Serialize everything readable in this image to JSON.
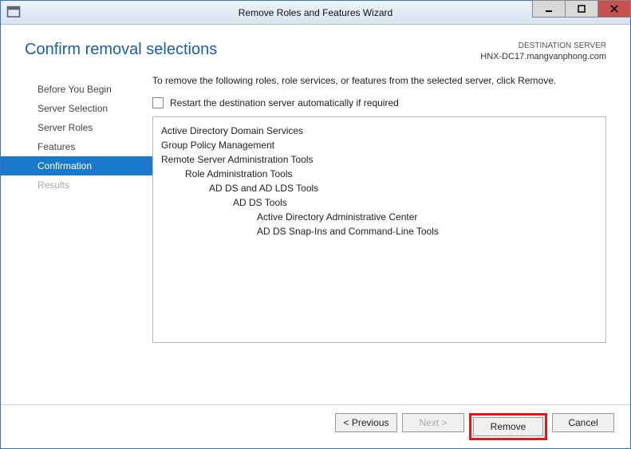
{
  "titlebar": {
    "title": "Remove Roles and Features Wizard"
  },
  "header": {
    "page_title": "Confirm removal selections",
    "dest_label": "DESTINATION SERVER",
    "dest_server": "HNX-DC17.mangvanphong.com"
  },
  "sidebar": {
    "steps": [
      {
        "label": "Before You Begin"
      },
      {
        "label": "Server Selection"
      },
      {
        "label": "Server Roles"
      },
      {
        "label": "Features"
      },
      {
        "label": "Confirmation"
      },
      {
        "label": "Results"
      }
    ]
  },
  "main": {
    "instruction": "To remove the following roles, role services, or features from the selected server, click Remove.",
    "restart_label": "Restart the destination server automatically if required",
    "tree": [
      {
        "level": 0,
        "text": "Active Directory Domain Services"
      },
      {
        "level": 0,
        "text": "Group Policy Management"
      },
      {
        "level": 0,
        "text": "Remote Server Administration Tools"
      },
      {
        "level": 1,
        "text": "Role Administration Tools"
      },
      {
        "level": 2,
        "text": "AD DS and AD LDS Tools"
      },
      {
        "level": 3,
        "text": "AD DS Tools"
      },
      {
        "level": 4,
        "text": "Active Directory Administrative Center"
      },
      {
        "level": 4,
        "text": "AD DS Snap-Ins and Command-Line Tools"
      }
    ]
  },
  "footer": {
    "previous": "< Previous",
    "next": "Next >",
    "remove": "Remove",
    "cancel": "Cancel"
  }
}
